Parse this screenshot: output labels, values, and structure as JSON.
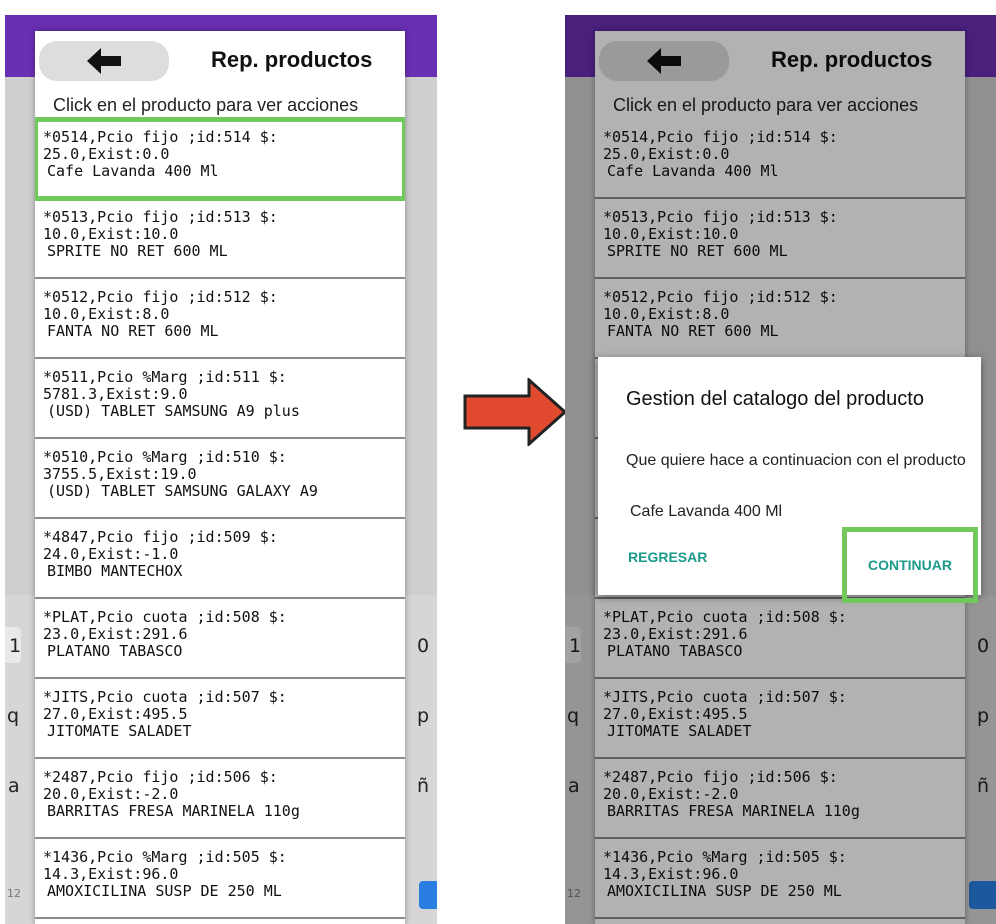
{
  "screen_left": {
    "dialog": {
      "title": "Rep. productos",
      "hint": "Click en el producto para ver acciones"
    },
    "products": [
      {
        "line1": "*0514,Pcio fijo ;id:514 $:",
        "line2": "25.0,Exist:0.0",
        "name": "Cafe Lavanda 400 Ml"
      },
      {
        "line1": "*0513,Pcio fijo ;id:513 $:",
        "line2": "10.0,Exist:10.0",
        "name": "SPRITE NO RET 600 ML"
      },
      {
        "line1": "*0512,Pcio fijo ;id:512 $:",
        "line2": "10.0,Exist:8.0",
        "name": "FANTA NO RET 600 ML"
      },
      {
        "line1": "*0511,Pcio %Marg ;id:511 $:",
        "line2": "5781.3,Exist:9.0",
        "name": "(USD) TABLET SAMSUNG A9 plus"
      },
      {
        "line1": "*0510,Pcio %Marg ;id:510 $:",
        "line2": "3755.5,Exist:19.0",
        "name": "(USD) TABLET SAMSUNG GALAXY A9"
      },
      {
        "line1": "*4847,Pcio fijo ;id:509 $:",
        "line2": "24.0,Exist:-1.0",
        "name": "BIMBO MANTECHOX"
      },
      {
        "line1": "*PLAT,Pcio cuota ;id:508 $:",
        "line2": "23.0,Exist:291.6",
        "name": "PLATANO TABASCO"
      },
      {
        "line1": "*JITS,Pcio cuota ;id:507 $:",
        "line2": "27.0,Exist:495.5",
        "name": "JITOMATE SALADET"
      },
      {
        "line1": "*2487,Pcio fijo ;id:506 $:",
        "line2": "20.0,Exist:-2.0",
        "name": "BARRITAS FRESA MARINELA 110g"
      },
      {
        "line1": "*1436,Pcio %Marg ;id:505 $:",
        "line2": "14.3,Exist:96.0",
        "name": "AMOXICILINA SUSP DE 250 ML"
      }
    ],
    "edge_glyphs": {
      "e1": "1",
      "e2": "q",
      "e3": "a",
      "e4": "0",
      "e5": "p",
      "e6": "ñ",
      "e7": "12"
    }
  },
  "screen_right": {
    "dialog": {
      "title": "Rep. productos",
      "hint": "Click en el producto para ver acciones"
    },
    "products": [
      {
        "line1": "*0514,Pcio fijo ;id:514 $:",
        "line2": "25.0,Exist:0.0",
        "name": "Cafe Lavanda 400 Ml"
      },
      {
        "line1": "*0513,Pcio fijo ;id:513 $:",
        "line2": "10.0,Exist:10.0",
        "name": "SPRITE NO RET 600 ML"
      },
      {
        "line1": "*0512,Pcio fijo ;id:512 $:",
        "line2": "10.0,Exist:8.0",
        "name": "FANTA NO RET 600 ML"
      },
      {
        "line1": "",
        "line2": "",
        "name": ""
      },
      {
        "line1": "",
        "line2": "",
        "name": ""
      },
      {
        "line1": "",
        "line2": "",
        "name": ""
      },
      {
        "line1": "*PLAT,Pcio cuota ;id:508 $:",
        "line2": "23.0,Exist:291.6",
        "name": "PLATANO TABASCO"
      },
      {
        "line1": "*JITS,Pcio cuota ;id:507 $:",
        "line2": "27.0,Exist:495.5",
        "name": "JITOMATE SALADET"
      },
      {
        "line1": "*2487,Pcio fijo ;id:506 $:",
        "line2": "20.0,Exist:-2.0",
        "name": "BARRITAS FRESA MARINELA 110g"
      },
      {
        "line1": "*1436,Pcio %Marg ;id:505 $:",
        "line2": "14.3,Exist:96.0",
        "name": "AMOXICILINA SUSP DE 250 ML"
      }
    ],
    "confirm": {
      "title": "Gestion del catalogo del producto",
      "message": "Que quiere hace a continuacion con el producto",
      "product": "Cafe Lavanda 400 Ml",
      "back_label": "REGRESAR",
      "continue_label": "CONTINUAR"
    },
    "edge_glyphs": {
      "e1": "1",
      "e2": "q",
      "e3": "a",
      "e4": "0",
      "e5": "p",
      "e6": "ñ",
      "e7": "12"
    }
  },
  "colors": {
    "highlight": "#72c85a",
    "arrow": "#e24a2f",
    "topbar": "#6a2fb3",
    "dialog_button_text": "#1b9a8a"
  },
  "icons": [
    "back-arrow-icon",
    "transition-arrow-icon"
  ]
}
